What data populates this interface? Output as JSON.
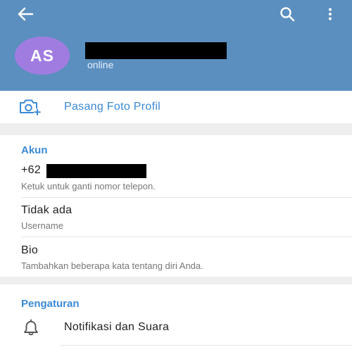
{
  "header": {
    "avatar_initials": "AS",
    "status": "online",
    "background_color": "#5b8fbf",
    "avatar_color": "#a17ce0",
    "back_icon": "arrow-left-icon",
    "search_icon": "search-icon",
    "more_icon": "more-vertical-icon"
  },
  "set_photo": {
    "label": "Pasang Foto Profil",
    "icon": "camera-add-icon"
  },
  "account": {
    "title": "Akun",
    "phone_prefix": "+62",
    "phone_hint": "Ketuk untuk ganti nomor telepon.",
    "username_value": "Tidak ada",
    "username_label": "Username",
    "bio_value": "Bio",
    "bio_hint": "Tambahkan beberapa kata tentang diri Anda."
  },
  "settings": {
    "title": "Pengaturan",
    "notifications_label": "Notifikasi dan Suara",
    "notifications_icon": "bell-icon"
  },
  "colors": {
    "accent": "#3a8ad6",
    "section_gap": "#eeeeee"
  }
}
